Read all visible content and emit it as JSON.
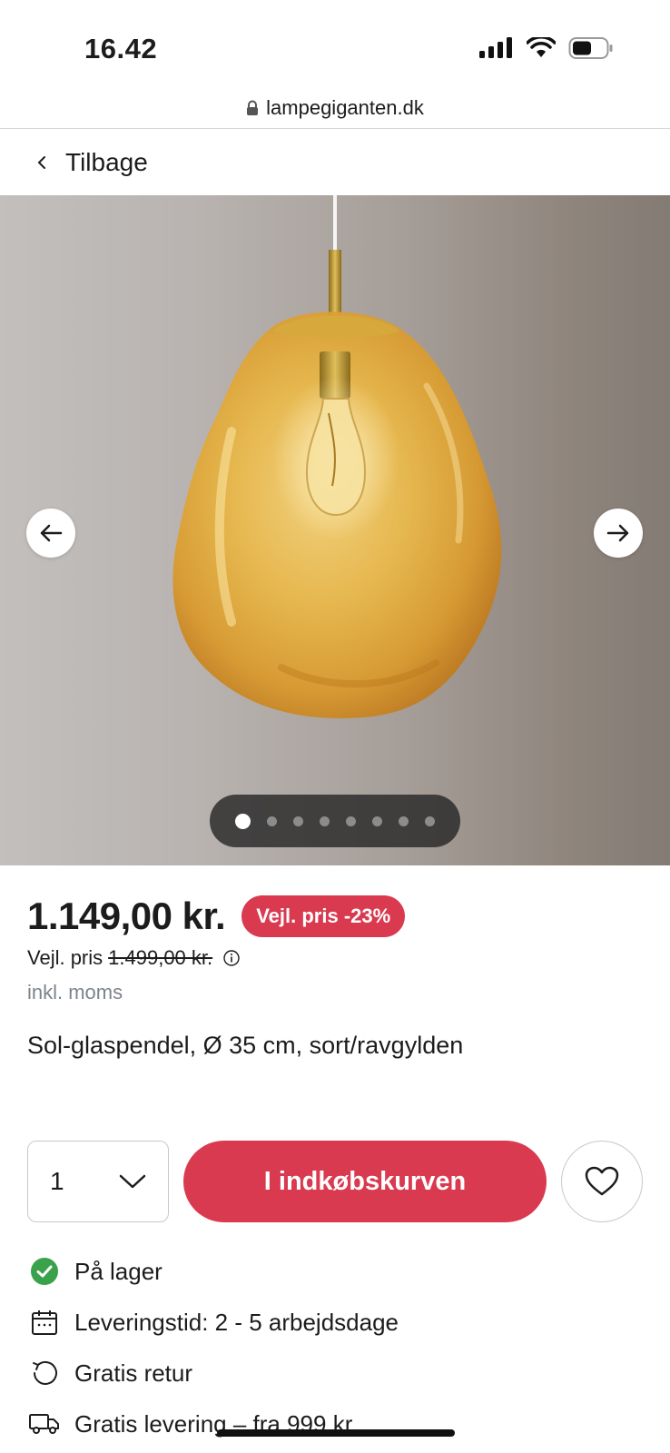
{
  "status": {
    "time": "16.42",
    "url": "lampegiganten.dk"
  },
  "nav": {
    "back_label": "Tilbage"
  },
  "gallery": {
    "image_count": 8,
    "active_index": 0
  },
  "product": {
    "price": "1.149,00 kr.",
    "discount_badge": "Vejl. pris -23%",
    "rrp_label": "Vejl. pris",
    "rrp_value": "1.499,00 kr.",
    "vat_note": "inkl. moms",
    "name": "Sol-glaspendel, Ø 35 cm, sort/ravgylden"
  },
  "buy": {
    "quantity": "1",
    "cart_button_label": "I indkøbskurven"
  },
  "info": [
    {
      "icon": "check-circle-icon",
      "label": "På lager"
    },
    {
      "icon": "calendar-icon",
      "label": "Leveringstid: 2 - 5 arbejdsdage"
    },
    {
      "icon": "return-icon",
      "label": "Gratis retur"
    },
    {
      "icon": "truck-icon",
      "label": "Gratis levering – fra 999 kr."
    }
  ],
  "colors": {
    "accent": "#d93a50",
    "in_stock": "#3aa24b"
  }
}
